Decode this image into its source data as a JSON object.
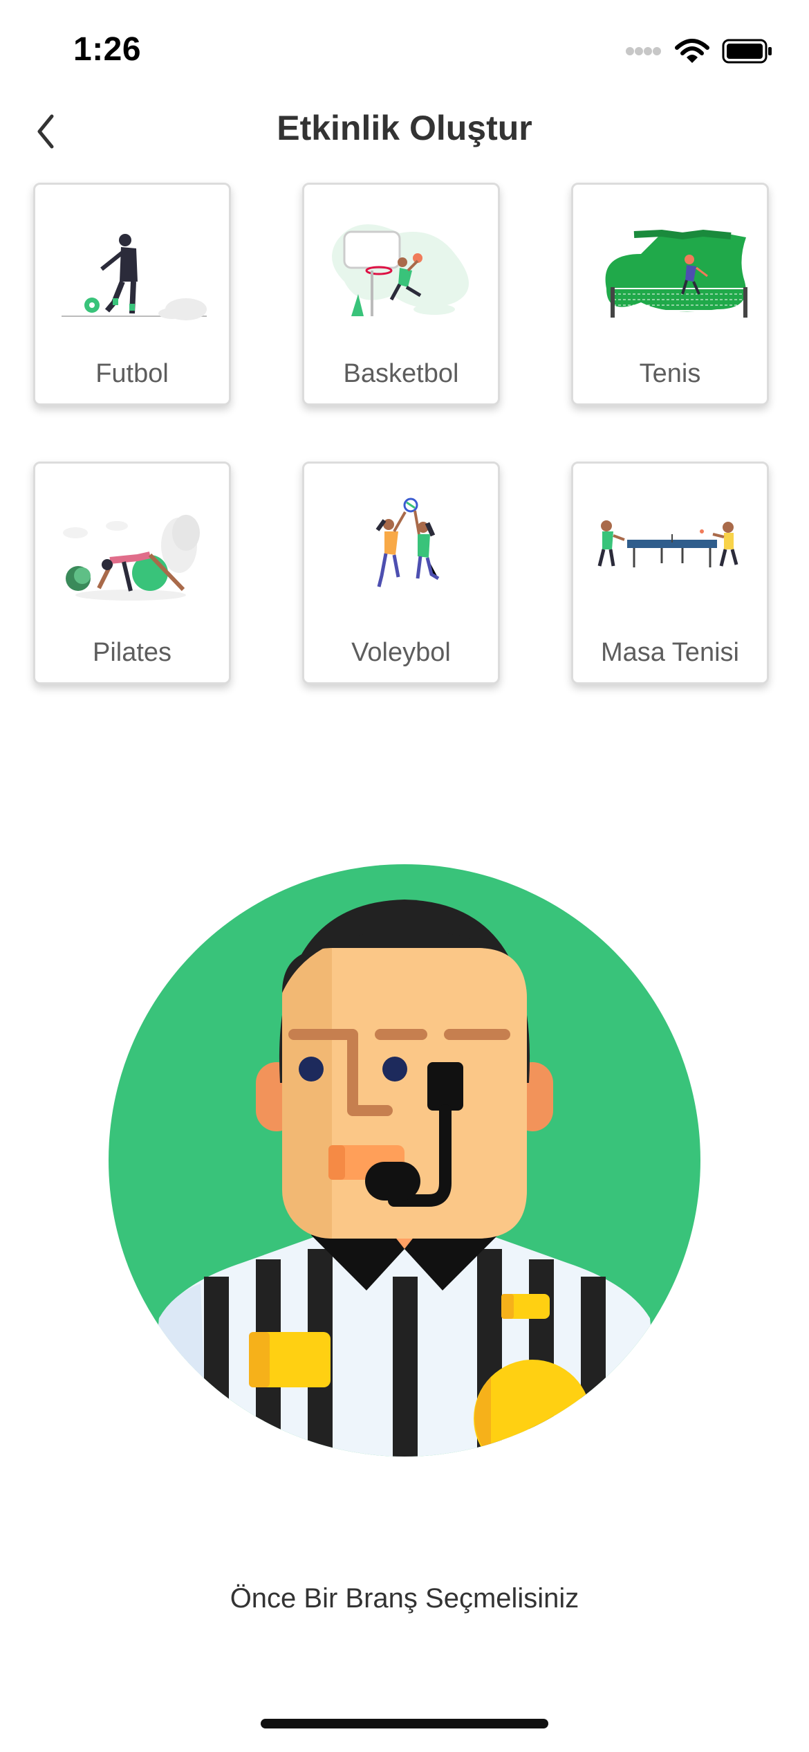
{
  "status_bar": {
    "time": "1:26",
    "icons": [
      "signal-icon",
      "wifi-icon",
      "battery-icon"
    ]
  },
  "nav": {
    "title": "Etkinlik Oluştur",
    "back_icon": "chevron-left-icon"
  },
  "sports": [
    {
      "label": "Futbol"
    },
    {
      "label": "Basketbol"
    },
    {
      "label": "Tenis"
    },
    {
      "label": "Pilates"
    },
    {
      "label": "Voleybol"
    },
    {
      "label": "Masa Tenisi"
    }
  ],
  "message": "Önce Bir Branş Seçmelisiniz",
  "colors": {
    "accent_green": "#39c37a",
    "stripe_black": "#222222",
    "skin": "#fbc787",
    "whistle": "#ffd012"
  }
}
